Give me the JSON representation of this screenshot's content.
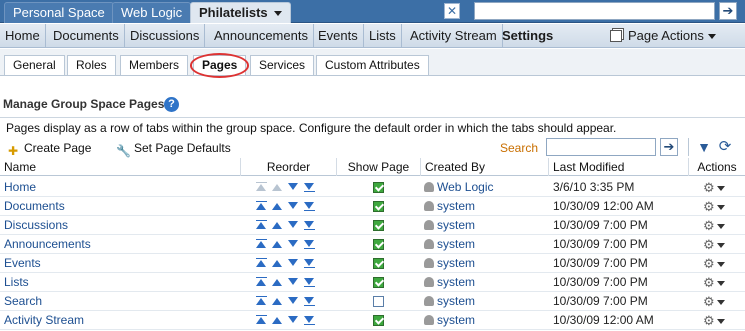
{
  "top_tabs": [
    {
      "label": "Personal Space"
    },
    {
      "label": "Web Logic"
    },
    {
      "label": "Philatelists"
    }
  ],
  "nav": {
    "items": [
      "Home",
      "Documents",
      "Discussions",
      "Announcements",
      "Events",
      "Lists",
      "Activity Stream",
      "Settings"
    ],
    "active": "Settings",
    "page_actions": "Page Actions"
  },
  "settings_tabs": [
    "General",
    "Roles",
    "Members",
    "Pages",
    "Services",
    "Custom Attributes"
  ],
  "active_settings_tab": "Pages",
  "section": {
    "title": "Manage Group Space Pages",
    "help": "?",
    "description": "Pages display as a row of tabs within the group space. Configure the default order in which the tabs should appear."
  },
  "toolbar": {
    "create_page": "Create Page",
    "set_defaults": "Set Page Defaults",
    "search_label": "Search",
    "search_value": "",
    "go_glyph": "➔"
  },
  "table": {
    "headers": {
      "name": "Name",
      "reorder": "Reorder",
      "show_page": "Show Page",
      "created_by": "Created By",
      "last_modified": "Last Modified",
      "actions": "Actions"
    },
    "rows": [
      {
        "name": "Home",
        "show": true,
        "created_by": "Web Logic",
        "modified": "3/6/10 3:35 PM",
        "first": true,
        "last": false
      },
      {
        "name": "Documents",
        "show": true,
        "created_by": "system",
        "modified": "10/30/09 12:00 AM",
        "first": false,
        "last": false
      },
      {
        "name": "Discussions",
        "show": true,
        "created_by": "system",
        "modified": "10/30/09 7:00 PM",
        "first": false,
        "last": false
      },
      {
        "name": "Announcements",
        "show": true,
        "created_by": "system",
        "modified": "10/30/09 7:00 PM",
        "first": false,
        "last": false
      },
      {
        "name": "Events",
        "show": true,
        "created_by": "system",
        "modified": "10/30/09 7:00 PM",
        "first": false,
        "last": false
      },
      {
        "name": "Lists",
        "show": true,
        "created_by": "system",
        "modified": "10/30/09 7:00 PM",
        "first": false,
        "last": false
      },
      {
        "name": "Search",
        "show": false,
        "created_by": "system",
        "modified": "10/30/09 7:00 PM",
        "first": false,
        "last": false
      },
      {
        "name": "Activity Stream",
        "show": true,
        "created_by": "system",
        "modified": "10/30/09 12:00 AM",
        "first": false,
        "last": false
      }
    ]
  },
  "colors": {
    "topbar": "#3c6fa6",
    "link": "#1d4f91",
    "search_label": "#c96f00",
    "highlight_circle": "#dd3333"
  }
}
